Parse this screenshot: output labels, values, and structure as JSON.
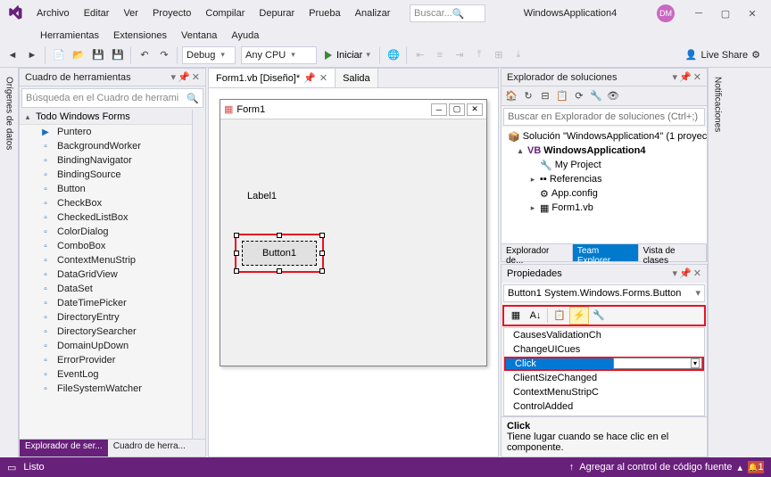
{
  "menus": [
    "Archivo",
    "Editar",
    "Ver",
    "Proyecto",
    "Compilar",
    "Depurar",
    "Prueba",
    "Analizar"
  ],
  "menus2": [
    "Herramientas",
    "Extensiones",
    "Ventana",
    "Ayuda"
  ],
  "search_placeholder": "Buscar...",
  "app_title": "WindowsApplication4",
  "avatar": "DM",
  "toolbar": {
    "config": "Debug",
    "platform": "Any CPU",
    "start": "Iniciar",
    "live_share": "Live Share"
  },
  "left_side_tabs": [
    "Orígenes de datos"
  ],
  "right_side_tabs": [
    "Notificaciones"
  ],
  "toolbox": {
    "title": "Cuadro de herramientas",
    "search_placeholder": "Búsqueda en el Cuadro de herrami",
    "group": "Todo Windows Forms",
    "items": [
      "Puntero",
      "BackgroundWorker",
      "BindingNavigator",
      "BindingSource",
      "Button",
      "CheckBox",
      "CheckedListBox",
      "ColorDialog",
      "ComboBox",
      "ContextMenuStrip",
      "DataGridView",
      "DataSet",
      "DateTimePicker",
      "DirectoryEntry",
      "DirectorySearcher",
      "DomainUpDown",
      "ErrorProvider",
      "EventLog",
      "FileSystemWatcher"
    ],
    "bottom_tabs": [
      "Explorador de ser...",
      "Cuadro de herra..."
    ]
  },
  "doc_tabs": {
    "active": "Form1.vb [Diseño]*",
    "other": "Salida"
  },
  "form": {
    "title": "Form1",
    "label": "Label1",
    "button": "Button1"
  },
  "solution_explorer": {
    "title": "Explorador de soluciones",
    "search_placeholder": "Buscar en Explorador de soluciones (Ctrl+;)",
    "solution": "Solución \"WindowsApplication4\" (1 proyec",
    "project": "WindowsApplication4",
    "nodes": [
      "My Project",
      "Referencias",
      "App.config",
      "Form1.vb"
    ],
    "tabs": [
      "Explorador de...",
      "Team Explorer",
      "Vista de clases"
    ]
  },
  "properties": {
    "title": "Propiedades",
    "object": "Button1 System.Windows.Forms.Button",
    "events_box": [
      "CausesValidationCh",
      "ChangeUICues",
      "Click",
      "ClientSizeChanged",
      "ContextMenuStripC",
      "ControlAdded"
    ],
    "selected_event": "Click",
    "desc_title": "Click",
    "desc_text": "Tiene lugar cuando se hace clic en el componente."
  },
  "status": {
    "ready": "Listo",
    "source_control": "Agregar al control de código fuente",
    "notifications": "1"
  }
}
